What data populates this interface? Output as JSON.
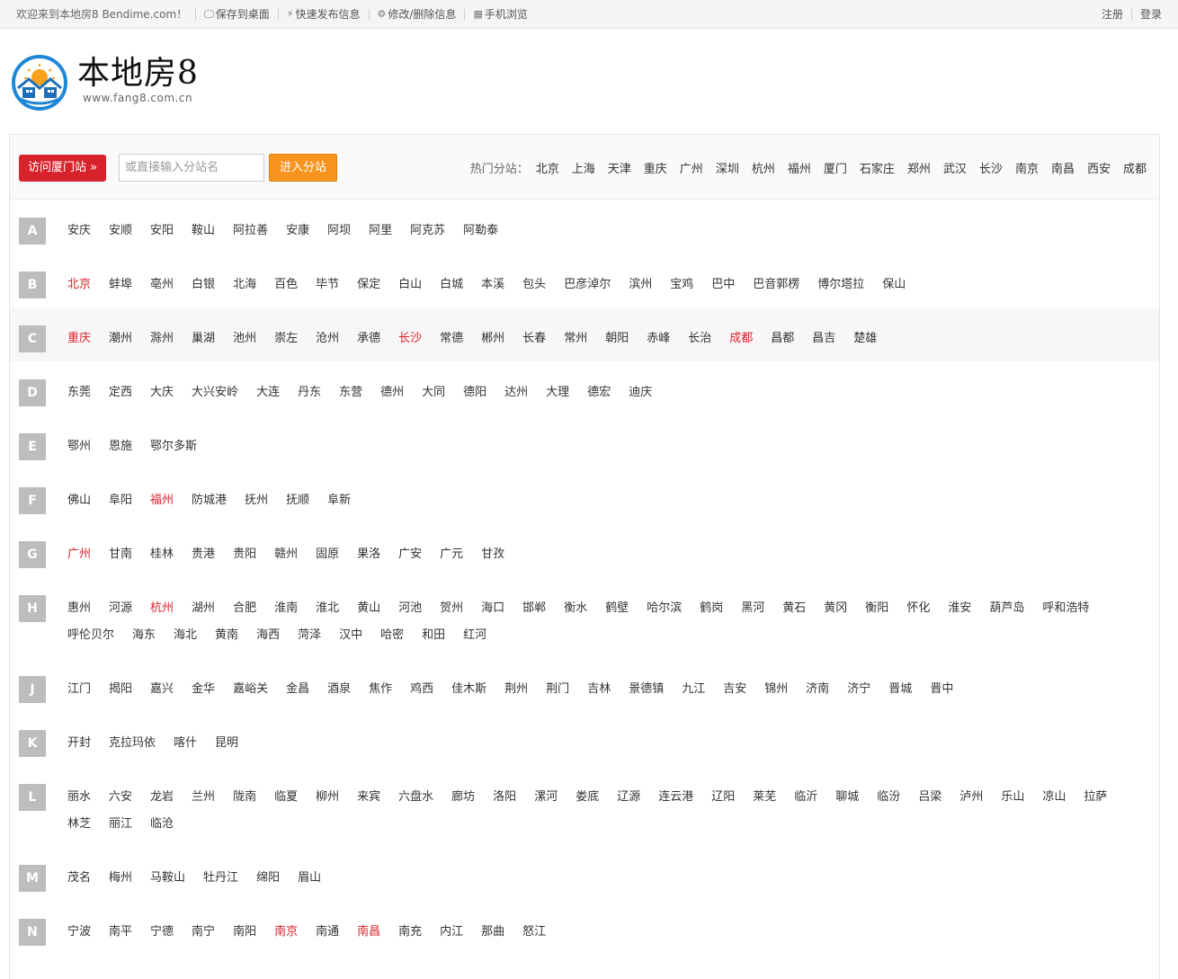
{
  "topbar": {
    "welcome": "欢迎来到本地房8 Bendime.com！",
    "links": [
      {
        "label": "保存到桌面",
        "icon": "monitor-icon",
        "glyph": "🖵"
      },
      {
        "label": "快速发布信息",
        "icon": "lightning-icon",
        "glyph": "⚡"
      },
      {
        "label": "修改/删除信息",
        "icon": "gear-icon",
        "glyph": "⚙"
      },
      {
        "label": "手机浏览",
        "icon": "qrcode-icon",
        "glyph": "▦"
      }
    ],
    "register": "注册",
    "login": "登录"
  },
  "logo": {
    "title": "本地房8",
    "url": "www.fang8.com.cn"
  },
  "search": {
    "visit_button": "访问厦门站 »",
    "input_placeholder": "或直接输入分站名",
    "enter_button": "进入分站",
    "hot_label": "热门分站：",
    "hot_cities": [
      "北京",
      "上海",
      "天津",
      "重庆",
      "广州",
      "深圳",
      "杭州",
      "福州",
      "厦门",
      "石家庄",
      "郑州",
      "武汉",
      "长沙",
      "南京",
      "南昌",
      "西安",
      "成都"
    ]
  },
  "colors": {
    "accent_red": "#d9232c",
    "accent_orange": "#f7941d",
    "letter_gray": "#bdbdbd"
  },
  "letters": [
    {
      "letter": "A",
      "cities": [
        "安庆",
        "安顺",
        "安阳",
        "鞍山",
        "阿拉善",
        "安康",
        "阿坝",
        "阿里",
        "阿克苏",
        "阿勒泰"
      ],
      "red": []
    },
    {
      "letter": "B",
      "cities": [
        "北京",
        "蚌埠",
        "亳州",
        "白银",
        "北海",
        "百色",
        "毕节",
        "保定",
        "白山",
        "白城",
        "本溪",
        "包头",
        "巴彦淖尔",
        "滨州",
        "宝鸡",
        "巴中",
        "巴音郭楞",
        "博尔塔拉",
        "保山"
      ],
      "red": [
        "北京"
      ]
    },
    {
      "letter": "C",
      "cities": [
        "重庆",
        "潮州",
        "滁州",
        "巢湖",
        "池州",
        "崇左",
        "沧州",
        "承德",
        "长沙",
        "常德",
        "郴州",
        "长春",
        "常州",
        "朝阳",
        "赤峰",
        "长治",
        "成都",
        "昌都",
        "昌吉",
        "楚雄"
      ],
      "red": [
        "重庆",
        "长沙",
        "成都"
      ]
    },
    {
      "letter": "D",
      "cities": [
        "东莞",
        "定西",
        "大庆",
        "大兴安岭",
        "大连",
        "丹东",
        "东营",
        "德州",
        "大同",
        "德阳",
        "达州",
        "大理",
        "德宏",
        "迪庆"
      ],
      "red": []
    },
    {
      "letter": "E",
      "cities": [
        "鄂州",
        "恩施",
        "鄂尔多斯"
      ],
      "red": []
    },
    {
      "letter": "F",
      "cities": [
        "佛山",
        "阜阳",
        "福州",
        "防城港",
        "抚州",
        "抚顺",
        "阜新"
      ],
      "red": [
        "福州"
      ]
    },
    {
      "letter": "G",
      "cities": [
        "广州",
        "甘南",
        "桂林",
        "贵港",
        "贵阳",
        "赣州",
        "固原",
        "果洛",
        "广安",
        "广元",
        "甘孜"
      ],
      "red": [
        "广州"
      ]
    },
    {
      "letter": "H",
      "cities": [
        "惠州",
        "河源",
        "杭州",
        "湖州",
        "合肥",
        "淮南",
        "淮北",
        "黄山",
        "河池",
        "贺州",
        "海口",
        "邯郸",
        "衡水",
        "鹤壁",
        "哈尔滨",
        "鹤岗",
        "黑河",
        "黄石",
        "黄冈",
        "衡阳",
        "怀化",
        "淮安",
        "葫芦岛",
        "呼和浩特",
        "呼伦贝尔",
        "海东",
        "海北",
        "黄南",
        "海西",
        "菏泽",
        "汉中",
        "哈密",
        "和田",
        "红河"
      ],
      "red": [
        "杭州"
      ]
    },
    {
      "letter": "J",
      "cities": [
        "江门",
        "揭阳",
        "嘉兴",
        "金华",
        "嘉峪关",
        "金昌",
        "酒泉",
        "焦作",
        "鸡西",
        "佳木斯",
        "荆州",
        "荆门",
        "吉林",
        "景德镇",
        "九江",
        "吉安",
        "锦州",
        "济南",
        "济宁",
        "晋城",
        "晋中"
      ],
      "red": []
    },
    {
      "letter": "K",
      "cities": [
        "开封",
        "克拉玛依",
        "喀什",
        "昆明"
      ],
      "red": []
    },
    {
      "letter": "L",
      "cities": [
        "丽水",
        "六安",
        "龙岩",
        "兰州",
        "陇南",
        "临夏",
        "柳州",
        "来宾",
        "六盘水",
        "廊坊",
        "洛阳",
        "漯河",
        "娄底",
        "辽源",
        "连云港",
        "辽阳",
        "莱芜",
        "临沂",
        "聊城",
        "临汾",
        "吕梁",
        "泸州",
        "乐山",
        "凉山",
        "拉萨",
        "林芝",
        "丽江",
        "临沧"
      ],
      "red": []
    },
    {
      "letter": "M",
      "cities": [
        "茂名",
        "梅州",
        "马鞍山",
        "牡丹江",
        "绵阳",
        "眉山"
      ],
      "red": []
    },
    {
      "letter": "N",
      "cities": [
        "宁波",
        "南平",
        "宁德",
        "南宁",
        "南阳",
        "南京",
        "南通",
        "南昌",
        "南充",
        "内江",
        "那曲",
        "怒江"
      ],
      "red": [
        "南京",
        "南昌"
      ]
    }
  ]
}
